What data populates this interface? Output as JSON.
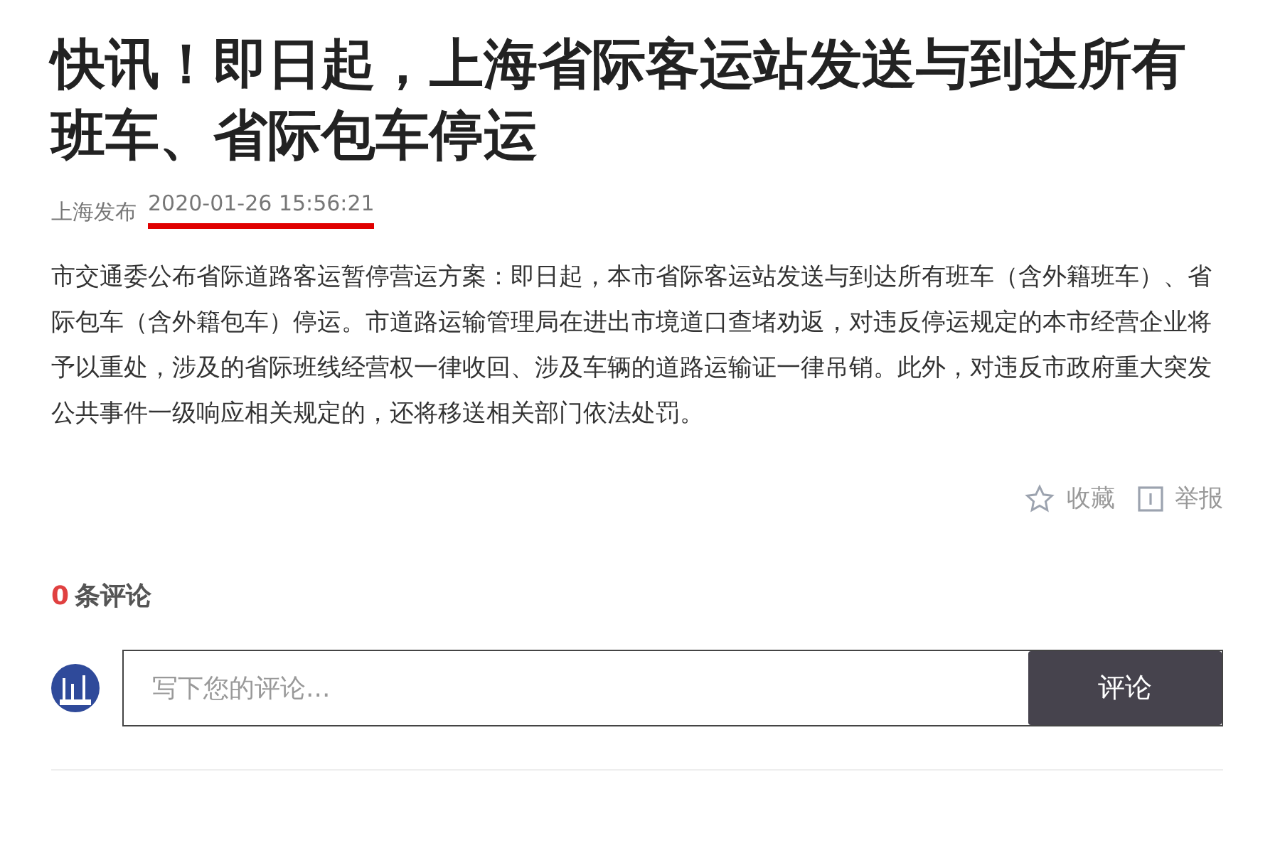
{
  "article": {
    "title": "快讯！即日起，上海省际客运站发送与到达所有班车、省际包车停运",
    "source": "上海发布",
    "date": {
      "text": "2020-01-26 15:56:21",
      "underlined": true
    },
    "body": "市交通委公布省际道路客运暂停营运方案：即日起，本市省际客运站发送与到达所有班车（含外籍班车）、省际包车（含外籍包车）停运。市道路运输管理局在进出市境道口查堵劝返，对违反停运规定的本市经营企业将予以重处，涉及的省际班线经营权一律收回、涉及车辆的道路运输证一律吊销。此外，对违反市政府重大突发公共事件一级响应相关规定的，还将移送相关部门依法处罚。",
    "actions": [
      {
        "kind": "favorite",
        "label": "收藏"
      },
      {
        "kind": "report",
        "label": "举报"
      }
    ]
  },
  "comments": {
    "count": "0",
    "label": "条评论",
    "placeholder": "写下您的评论...",
    "submit": "评论"
  }
}
